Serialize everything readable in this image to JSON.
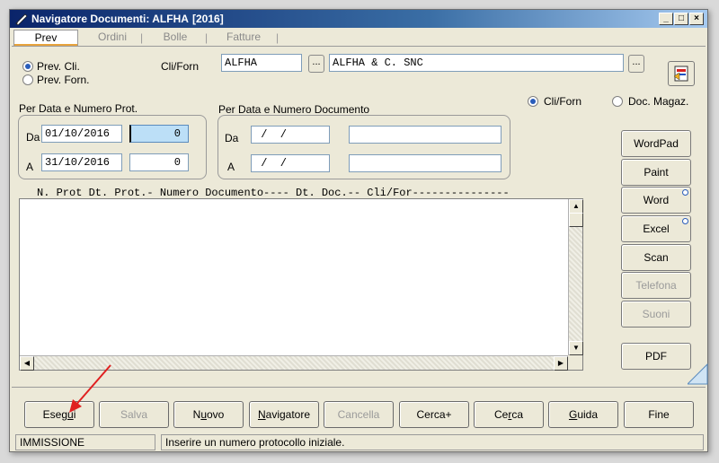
{
  "window": {
    "title": "Navigatore Documenti: ALFHA",
    "year": "[2016]",
    "controls": {
      "minimize": "_",
      "maximize": "□",
      "close": "×"
    }
  },
  "tabs": [
    "Prev",
    "Ordini",
    "Bolle",
    "Fatture"
  ],
  "tab_separator": "|",
  "type_radio": {
    "options": [
      "Prev. Cli.",
      "Prev. Forn."
    ],
    "selected": "Prev. Cli."
  },
  "cliforn": {
    "label": "Cli/Forn",
    "code": "ALFHA",
    "name": "ALFHA & C. SNC",
    "lookup_label": "..."
  },
  "scope_radio": {
    "options": [
      "Cli/Forn",
      "Doc. Magaz."
    ],
    "selected": "Cli/Forn"
  },
  "prot_group": {
    "title": "Per Data e Numero Prot.",
    "da_label": "Da",
    "a_label": "A",
    "da_date": "01/10/2016",
    "da_num": "0",
    "a_date": "31/10/2016",
    "a_num": "0"
  },
  "doc_group": {
    "title": "Per Data e Numero Documento",
    "da_label": "Da",
    "a_label": "A",
    "da_date": " /  /",
    "a_date": " /  /",
    "da_num": "",
    "a_num": ""
  },
  "list_header": "N. Prot Dt. Prot.- Numero Documento---- Dt. Doc.-- Cli/For---------------",
  "side_buttons": [
    {
      "label": "WordPad",
      "enabled": true
    },
    {
      "label": "Paint",
      "enabled": true
    },
    {
      "label": "Word",
      "enabled": true,
      "indicator": true
    },
    {
      "label": "Excel",
      "enabled": true,
      "indicator": true
    },
    {
      "label": "Scan",
      "enabled": true
    },
    {
      "label": "Telefona",
      "enabled": false
    },
    {
      "label": "Suoni",
      "enabled": false
    },
    {
      "label": "PDF",
      "enabled": true
    }
  ],
  "bottom_buttons": [
    {
      "pre": "Eseg",
      "key": "u",
      "post": "i",
      "enabled": true
    },
    {
      "pre": "",
      "key": "",
      "post": "Salva",
      "enabled": false
    },
    {
      "pre": "N",
      "key": "u",
      "post": "ovo",
      "enabled": true
    },
    {
      "pre": "",
      "key": "N",
      "post": "avigatore",
      "enabled": true
    },
    {
      "pre": "",
      "key": "",
      "post": "Cancella",
      "enabled": false
    },
    {
      "pre": "Cerca+",
      "key": "",
      "post": "",
      "enabled": true
    },
    {
      "pre": "Ce",
      "key": "r",
      "post": "ca",
      "enabled": true
    },
    {
      "pre": "",
      "key": "G",
      "post": "uida",
      "enabled": true
    },
    {
      "pre": "Fine",
      "key": "",
      "post": "",
      "enabled": true
    }
  ],
  "status": {
    "mode": "IMMISSIONE",
    "message": "Inserire un numero protocollo iniziale."
  },
  "colors": {
    "title_bar": "#0a246a",
    "window_bg": "#ece9d8",
    "highlight_field": "#bcdff7",
    "annotation_arrow": "#e02020"
  }
}
